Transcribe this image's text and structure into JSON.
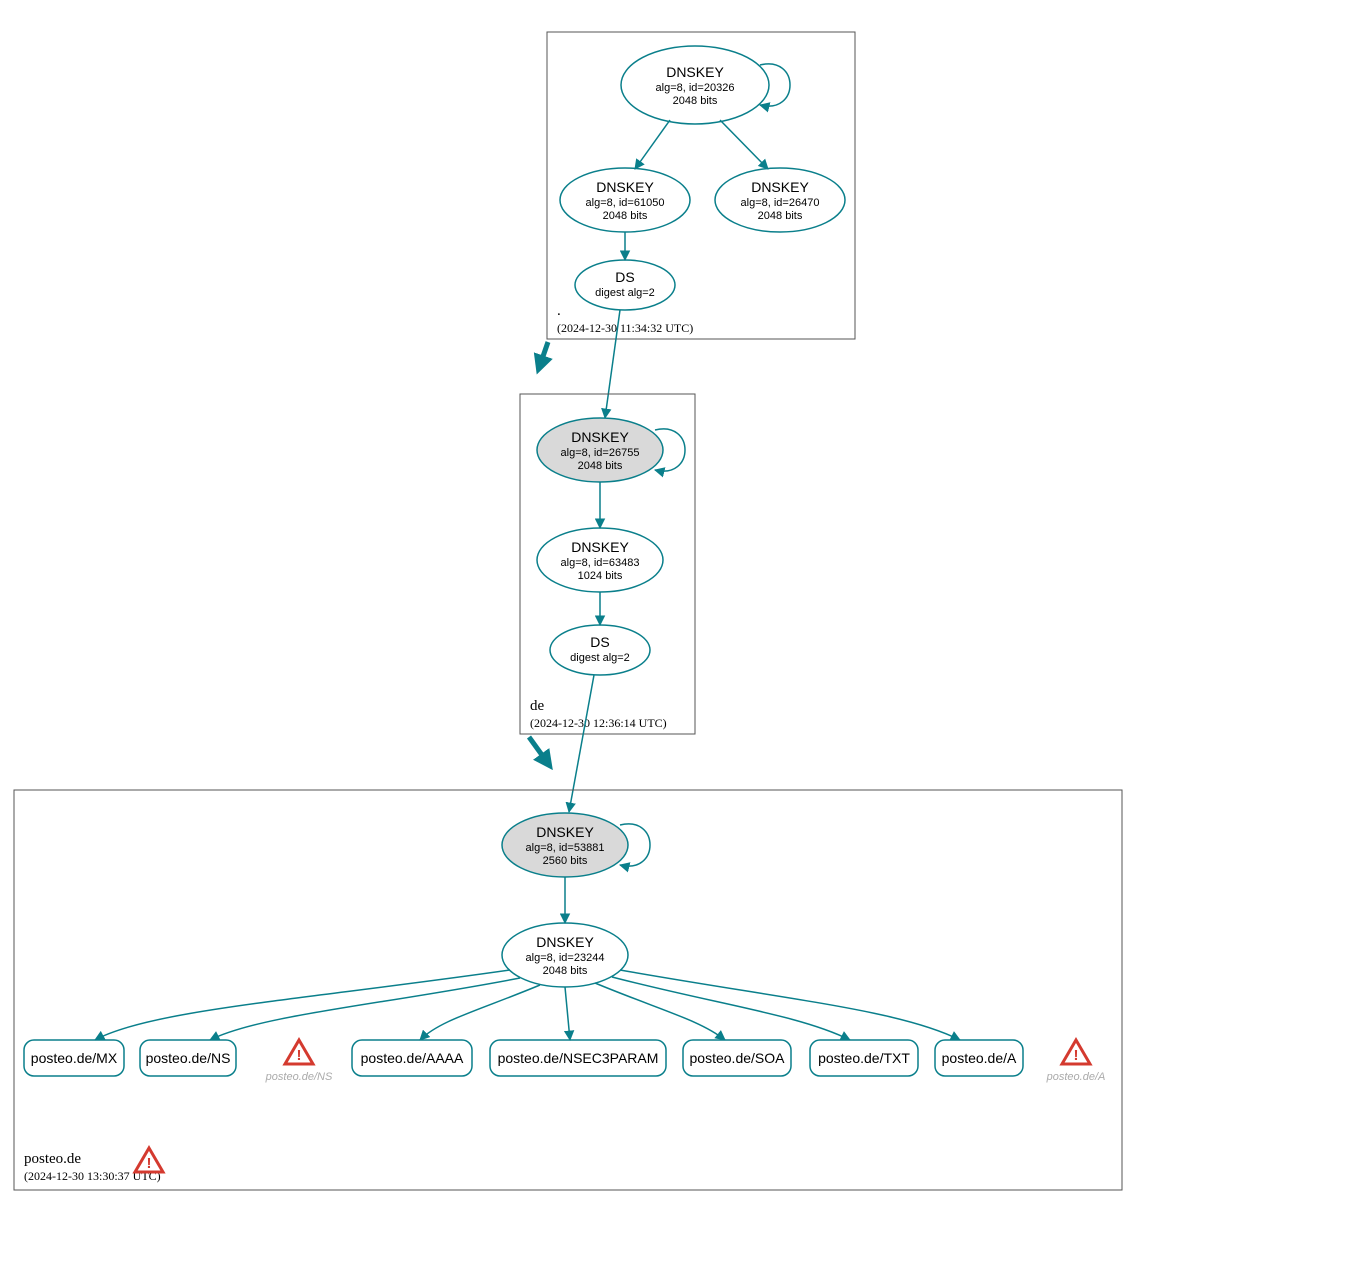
{
  "colors": {
    "teal": "#0a7f8b",
    "kskFill": "#d9d9d9",
    "warnRed": "#d43a2f",
    "greyText": "#aaaaaa"
  },
  "zones": {
    "root": {
      "name": ".",
      "timestamp": "(2024-12-30 11:34:32 UTC)"
    },
    "de": {
      "name": "de",
      "timestamp": "(2024-12-30 12:36:14 UTC)"
    },
    "posteo": {
      "name": "posteo.de",
      "timestamp": "(2024-12-30 13:30:37 UTC)"
    }
  },
  "nodes": {
    "rootKSK": {
      "title": "DNSKEY",
      "line1": "alg=8, id=20326",
      "line2": "2048 bits"
    },
    "rootZSK1": {
      "title": "DNSKEY",
      "line1": "alg=8, id=61050",
      "line2": "2048 bits"
    },
    "rootZSK2": {
      "title": "DNSKEY",
      "line1": "alg=8, id=26470",
      "line2": "2048 bits"
    },
    "rootDS": {
      "title": "DS",
      "line1": "digest alg=2"
    },
    "deKSK": {
      "title": "DNSKEY",
      "line1": "alg=8, id=26755",
      "line2": "2048 bits"
    },
    "deZSK": {
      "title": "DNSKEY",
      "line1": "alg=8, id=63483",
      "line2": "1024 bits"
    },
    "deDS": {
      "title": "DS",
      "line1": "digest alg=2"
    },
    "posteoKSK": {
      "title": "DNSKEY",
      "line1": "alg=8, id=53881",
      "line2": "2560 bits"
    },
    "posteoZSK": {
      "title": "DNSKEY",
      "line1": "alg=8, id=23244",
      "line2": "2048 bits"
    }
  },
  "records": {
    "mx": "posteo.de/MX",
    "ns": "posteo.de/NS",
    "aaaa": "posteo.de/AAAA",
    "nsec3param": "posteo.de/NSEC3PARAM",
    "soa": "posteo.de/SOA",
    "txt": "posteo.de/TXT",
    "a": "posteo.de/A"
  },
  "warnings": {
    "ns": "posteo.de/NS",
    "a": "posteo.de/A"
  }
}
